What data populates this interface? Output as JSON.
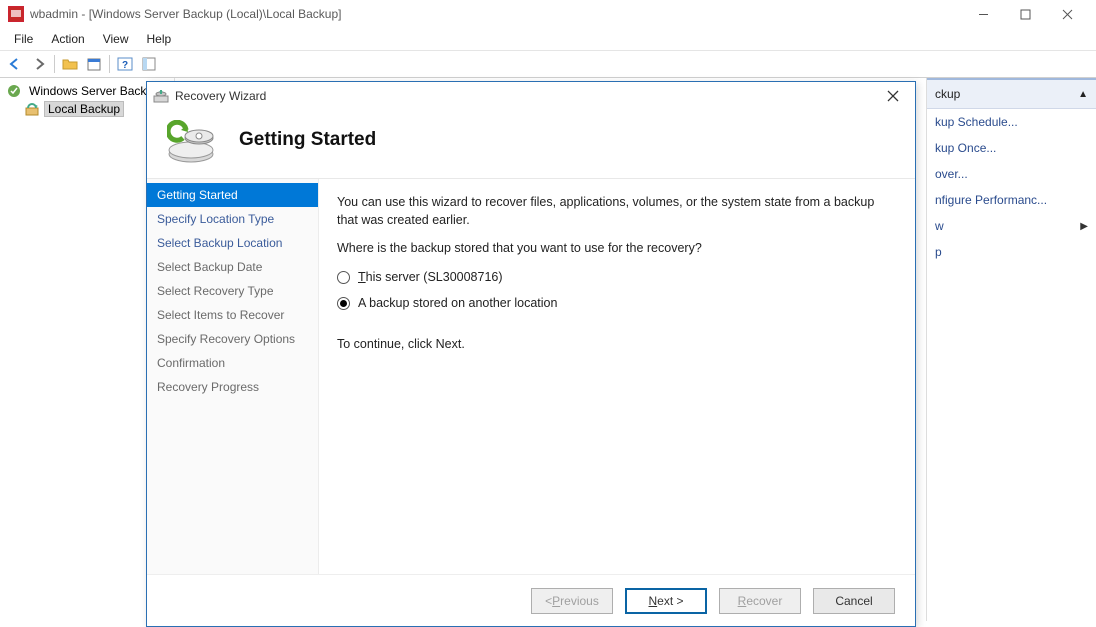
{
  "window": {
    "title": "wbadmin - [Windows Server Backup (Local)\\Local Backup]"
  },
  "menu": {
    "file": "File",
    "action": "Action",
    "view": "View",
    "help": "Help"
  },
  "toolbar": {
    "back_icon": "←",
    "fwd_icon": "→"
  },
  "tree": {
    "root": "Windows Server Backu",
    "child": "Local Backup"
  },
  "actions_pane": {
    "header_suffix": "ckup",
    "items": {
      "schedule": "kup Schedule...",
      "once": "kup Once...",
      "recover": "over...",
      "perf": "nfigure Performanc..."
    },
    "view_label": "w",
    "help_label": "p"
  },
  "wizard": {
    "title": "Recovery Wizard",
    "heading": "Getting Started",
    "steps": {
      "s1": "Getting Started",
      "s2": "Specify Location Type",
      "s3": "Select Backup Location",
      "s4": "Select Backup Date",
      "s5": "Select Recovery Type",
      "s6": "Select Items to Recover",
      "s7": "Specify Recovery Options",
      "s8": "Confirmation",
      "s9": "Recovery Progress"
    },
    "content": {
      "intro": "You can use this wizard to recover files, applications, volumes, or the system state from a backup that was created earlier.",
      "question": "Where is the backup stored that you want to use for the recovery?",
      "opt_this_prefix": "T",
      "opt_this_rest": "his server (SL30008716)",
      "opt_other": "A backup stored on another location",
      "continue": "To continue, click Next."
    },
    "buttons": {
      "previous_lt": "< ",
      "previous_u": "P",
      "previous_rest": "revious",
      "next_u": "N",
      "next_rest": "ext >",
      "recover_u": "R",
      "recover_rest": "ecover",
      "cancel": "Cancel"
    }
  }
}
